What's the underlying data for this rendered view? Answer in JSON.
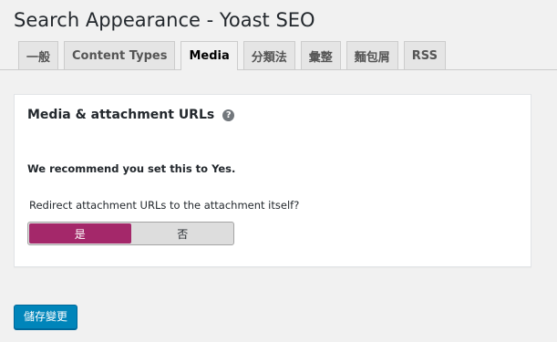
{
  "page_title": "Search Appearance - Yoast SEO",
  "tabs": [
    {
      "label": "一般",
      "active": false
    },
    {
      "label": "Content Types",
      "active": false
    },
    {
      "label": "Media",
      "active": true
    },
    {
      "label": "分類法",
      "active": false
    },
    {
      "label": "彙整",
      "active": false
    },
    {
      "label": "麵包屑",
      "active": false
    },
    {
      "label": "RSS",
      "active": false
    }
  ],
  "card": {
    "title": "Media & attachment URLs",
    "help_icon": "question-mark-icon",
    "help_glyph": "?",
    "recommendation": "We recommend you set this to Yes.",
    "question": "Redirect attachment URLs to the attachment itself?",
    "toggle": {
      "options": [
        "是",
        "否"
      ],
      "selected": "是"
    }
  },
  "save_button": "儲存變更",
  "colors": {
    "background": "#f1f1f1",
    "toggle_selected": "#a4286a",
    "primary_button": "#0085ba",
    "help_icon": "#72777c"
  }
}
